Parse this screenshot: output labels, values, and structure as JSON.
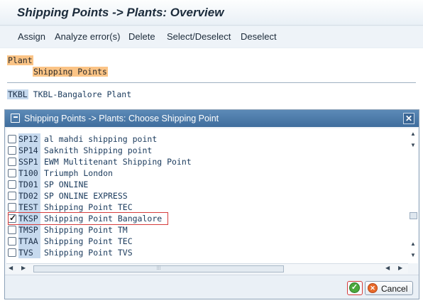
{
  "window": {
    "title": "Shipping Points -> Plants: Overview"
  },
  "toolbar": {
    "buttons": [
      "Assign",
      "Analyze error(s)",
      "Delete",
      "Select/Deselect",
      "Deselect"
    ]
  },
  "content": {
    "header1": "Plant",
    "header2": "Shipping Points",
    "plant_code": "TKBL",
    "plant_desc": "TKBL-Bangalore Plant"
  },
  "dialog": {
    "title": "Shipping Points -> Plants: Choose Shipping Point",
    "close_glyph": "✕",
    "rows": [
      {
        "code": "SP12",
        "desc": "al mahdi shipping point",
        "checked": false
      },
      {
        "code": "SP14",
        "desc": "Saknith Shipping point",
        "checked": false
      },
      {
        "code": "SSP1",
        "desc": "EWM Multitenant Shipping Point",
        "checked": false
      },
      {
        "code": "T100",
        "desc": "Triumph  London",
        "checked": false
      },
      {
        "code": "TD01",
        "desc": "SP ONLINE",
        "checked": false
      },
      {
        "code": "TD02",
        "desc": "SP ONLINE EXPRESS",
        "checked": false
      },
      {
        "code": "TEST",
        "desc": "Shipping Point TEC",
        "checked": false
      },
      {
        "code": "TKSP",
        "desc": "Shipping Point Bangalore",
        "checked": true
      },
      {
        "code": "TMSP",
        "desc": "Shipping Point TM",
        "checked": false
      },
      {
        "code": "TTAA",
        "desc": "Shipping Point TEC",
        "checked": false
      },
      {
        "code": "TVS",
        "desc": "Shipping Point TVS",
        "checked": false
      }
    ],
    "cancel_label": "Cancel",
    "ok_glyph": "✓",
    "cancel_glyph": "✕"
  },
  "colors": {
    "accent": "#3f6d9d",
    "highlight_orange": "#fbc486",
    "highlight_blue": "#c6d9ee",
    "selection_outline": "#d63d3d"
  }
}
